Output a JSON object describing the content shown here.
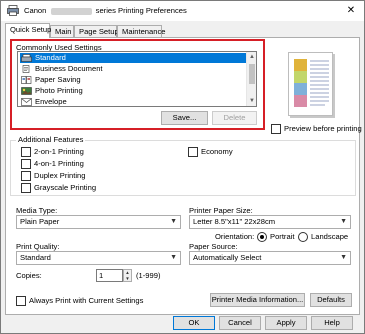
{
  "window": {
    "title_prefix": "Canon",
    "title_suffix": "series Printing Preferences",
    "close_glyph": "✕"
  },
  "tabs": [
    {
      "label": "Quick Setup"
    },
    {
      "label": "Main"
    },
    {
      "label": "Page Setup"
    },
    {
      "label": "Maintenance"
    }
  ],
  "commonly_used": {
    "label": "Commonly Used Settings",
    "items": [
      {
        "label": "Standard",
        "icon": "standard-printer-icon"
      },
      {
        "label": "Business Document",
        "icon": "business-document-icon"
      },
      {
        "label": "Paper Saving",
        "icon": "paper-saving-icon"
      },
      {
        "label": "Photo Printing",
        "icon": "photo-printing-icon"
      },
      {
        "label": "Envelope",
        "icon": "envelope-icon"
      }
    ],
    "save_button": "Save...",
    "delete_button": "Delete"
  },
  "preview_checkbox": {
    "label": "Preview before printing"
  },
  "additional_features": {
    "label": "Additional Features",
    "items": [
      {
        "label": "2-on-1 Printing"
      },
      {
        "label": "4-on-1 Printing"
      },
      {
        "label": "Duplex Printing"
      },
      {
        "label": "Grayscale Printing"
      },
      {
        "label": "Economy"
      }
    ]
  },
  "media_type": {
    "label": "Media Type:",
    "value": "Plain Paper"
  },
  "printer_paper_size": {
    "label": "Printer Paper Size:",
    "value": "Letter 8.5\"x11\" 22x28cm"
  },
  "orientation": {
    "label": "Orientation:",
    "portrait": "Portrait",
    "landscape": "Landscape",
    "selected": "Portrait"
  },
  "print_quality": {
    "label": "Print Quality:",
    "value": "Standard"
  },
  "paper_source": {
    "label": "Paper Source:",
    "value": "Automatically Select"
  },
  "copies": {
    "label": "Copies:",
    "value": "1",
    "range": "(1-999)"
  },
  "always_print": {
    "label": "Always Print with Current Settings"
  },
  "buttons": {
    "printer_media_info": "Printer Media Information...",
    "defaults": "Defaults",
    "ok": "OK",
    "cancel": "Cancel",
    "apply": "Apply",
    "help": "Help"
  },
  "colors": {
    "selection": "#0078d7",
    "highlight_border": "#d61f26"
  }
}
